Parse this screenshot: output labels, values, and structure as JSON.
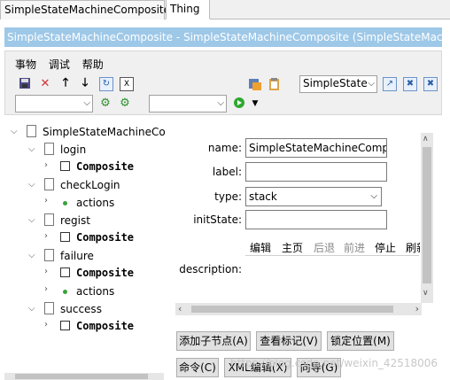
{
  "tabs": [
    {
      "label": "SimpleStateMachineComposite"
    },
    {
      "label": "Thing"
    }
  ],
  "title_bar": "SimpleStateMachineComposite - SimpleStateMachineComposite  (SimpleStateMachi",
  "menu": {
    "items": [
      "事物",
      "调试",
      "帮助"
    ]
  },
  "toolbar": {
    "combo_right": "SimpleState"
  },
  "tree": {
    "root": "SimpleStateMachineCor",
    "nodes": [
      {
        "label": "login",
        "children": [
          "Composite"
        ]
      },
      {
        "label": "checkLogin",
        "children": [
          "actions"
        ]
      },
      {
        "label": "regist",
        "children": [
          "Composite"
        ]
      },
      {
        "label": "failure",
        "children": [
          "Composite",
          "actions"
        ]
      },
      {
        "label": "success",
        "children": [
          "Composite"
        ]
      }
    ]
  },
  "form": {
    "name_label": "name:",
    "name_value": "SimpleStateMachineComp",
    "label_label": "label:",
    "label_value": "",
    "type_label": "type:",
    "type_value": "stack",
    "init_label": "initState:",
    "init_value": "",
    "description_label": "description:",
    "browser_links": [
      "编辑",
      "主页",
      "后退",
      "前进",
      "停止",
      "刷新"
    ]
  },
  "buttons": {
    "add_child": "添加子节点(A)",
    "view_marks": "查看标记(V)",
    "lock_position": "锁定位置(M)",
    "command": "命令(C)",
    "xml_edit": "XML编辑(X)",
    "guide": "向导(G)"
  },
  "watermark": "https://blog.csdn.net/weixin_42518006"
}
